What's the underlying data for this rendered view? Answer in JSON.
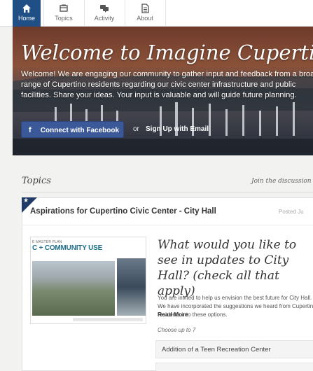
{
  "nav": {
    "tabs": [
      {
        "label": "Home",
        "icon": "home-icon",
        "active": true
      },
      {
        "label": "Topics",
        "icon": "topics-icon",
        "active": false
      },
      {
        "label": "Activity",
        "icon": "activity-icon",
        "active": false
      },
      {
        "label": "About",
        "icon": "about-icon",
        "active": false
      }
    ]
  },
  "hero": {
    "title": "Welcome to Imagine Cupertino",
    "intro": "Welcome! We are engaging our community to gather input and feedback from a broad range of Cupertino residents regarding our civic center infrastructure and public facilities. Share your ideas. Your input is valuable and will guide future planning.",
    "facebook_button": "Connect with Facebook",
    "or_text": "or",
    "email_link": "Sign Up with Email"
  },
  "topics": {
    "heading": "Topics",
    "join_text": "Join the discussion"
  },
  "card": {
    "title": "Aspirations for Cupertino Civic Center - City Hall",
    "posted": "Posted Ju",
    "thumb_subtitle": "E MASTER PLAN",
    "thumb_heading": "C + COMMUNITY USE",
    "question": "What would you like to see in updates to City Hall? (check all that apply)",
    "description": "You are invited to help us envision the best future for City Hall. We have incorporated the suggestions we heard from Cupertino residents into these options.",
    "read_more": "Read More",
    "choose": "Choose up to 7",
    "options": [
      "Addition of a Teen Recreation Center"
    ]
  },
  "colors": {
    "nav_active": "#1f4f85",
    "facebook": "#3b5998",
    "corner_badge": "#1f3a66"
  }
}
